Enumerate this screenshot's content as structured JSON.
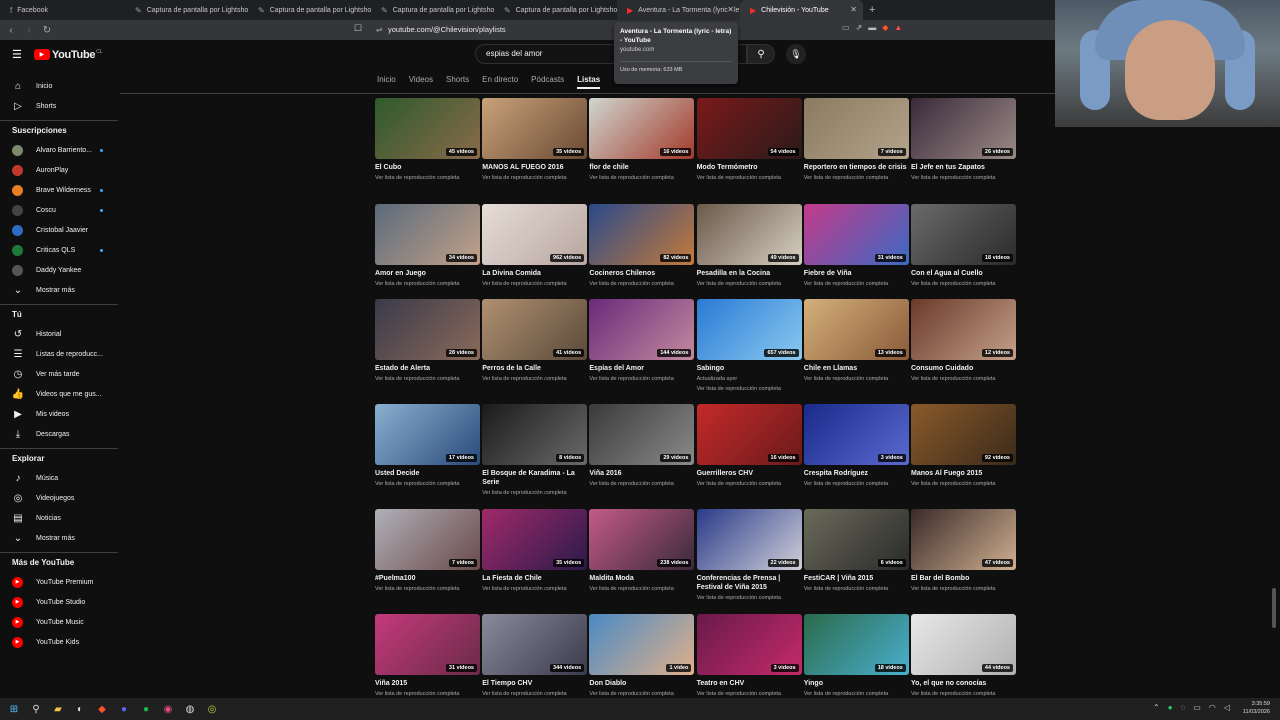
{
  "browser": {
    "tabs": [
      {
        "title": "Facebook",
        "icon": "facebook-icon"
      },
      {
        "title": "Captura de pantalla por Lightshot",
        "icon": "feather-icon"
      },
      {
        "title": "Captura de pantalla por Lightshot",
        "icon": "feather-icon"
      },
      {
        "title": "Captura de pantalla por Lightshot",
        "icon": "feather-icon"
      },
      {
        "title": "Captura de pantalla por Lightshot",
        "icon": "feather-icon"
      },
      {
        "title": "Aventura - La Tormenta (lyric - le",
        "icon": "youtube-icon"
      },
      {
        "title": "Chilevisión - YouTube",
        "icon": "youtube-icon"
      }
    ],
    "new_tab": "+",
    "url": "youtube.com/@Chilevision/playlists",
    "tooltip": {
      "title": "Aventura - La Tormenta (lyric - letra) - YouTube",
      "domain": "youtube.com",
      "memory": "Uso de memoria: 633 MB"
    }
  },
  "youtube": {
    "logo": "YouTube",
    "logo_country": "CL",
    "search_value": "espias del amor",
    "channel_tabs": [
      "Inicio",
      "Videos",
      "Shorts",
      "En directo",
      "Pódcasts",
      "Listas"
    ],
    "active_tab": "Listas"
  },
  "sidebar": {
    "main": [
      {
        "label": "Inicio",
        "icon": "home-icon"
      },
      {
        "label": "Shorts",
        "icon": "shorts-icon"
      }
    ],
    "subs_header": "Suscripciones",
    "subscriptions": [
      {
        "label": "Alvaro Barriento...",
        "color": "#7a8a6a"
      },
      {
        "label": "AuronPlay",
        "color": "#c0392b"
      },
      {
        "label": "Brave Wilderness",
        "color": "#e67e22"
      },
      {
        "label": "Coscu",
        "color": "#444444"
      },
      {
        "label": "Cristobal Jaavier",
        "color": "#2d6bc4"
      },
      {
        "label": "Criticas QLS",
        "color": "#1f7a3a"
      },
      {
        "label": "Daddy Yankee",
        "color": "#555555"
      }
    ],
    "show_more": "Mostrar más",
    "you_header": "Tú",
    "you": [
      {
        "label": "Historial",
        "icon": "history-icon"
      },
      {
        "label": "Listas de reproducc...",
        "icon": "playlist-icon"
      },
      {
        "label": "Ver más tarde",
        "icon": "clock-icon"
      },
      {
        "label": "Videos que me gus...",
        "icon": "thumbs-up-icon"
      },
      {
        "label": "Mis videos",
        "icon": "video-icon"
      },
      {
        "label": "Descargas",
        "icon": "download-icon"
      }
    ],
    "explore_header": "Explorar",
    "explore": [
      {
        "label": "Música",
        "icon": "music-icon"
      },
      {
        "label": "Videojuegos",
        "icon": "gamepad-icon"
      },
      {
        "label": "Noticias",
        "icon": "news-icon"
      },
      {
        "label": "Mostrar más",
        "icon": "chevron-down-icon"
      }
    ],
    "more_header": "Más de YouTube",
    "more": [
      {
        "label": "YouTube Premium"
      },
      {
        "label": "YouTube Studio"
      },
      {
        "label": "YouTube Music"
      },
      {
        "label": "YouTube Kids"
      }
    ]
  },
  "playlists": [
    {
      "title": "El Cubo",
      "count": "45 videos",
      "sub": "Ver lista de reproducción completa",
      "c1": "#2f5a2c",
      "c2": "#8a6a4a"
    },
    {
      "title": "MANOS AL FUEGO 2016",
      "count": "35 videos",
      "sub": "Ver lista de reproducción completa",
      "c1": "#c9a27a",
      "c2": "#6b4a34"
    },
    {
      "title": "flor de chile",
      "count": "16 videos",
      "sub": "Ver lista de reproducción completa",
      "c1": "#cfd6d0",
      "c2": "#a33a2a"
    },
    {
      "title": "Modo Termómetro",
      "count": "54 videos",
      "sub": "Ver lista de reproducción completa",
      "c1": "#7a1a1a",
      "c2": "#2a1a1a"
    },
    {
      "title": "Reportero en tiempos de crisis",
      "count": "7 videos",
      "sub": "Ver lista de reproducción completa",
      "c1": "#8a7a60",
      "c2": "#b2a38a"
    },
    {
      "title": "El Jefe en tus Zapatos",
      "count": "26 videos",
      "sub": "Ver lista de reproducción completa",
      "c1": "#3a2a3a",
      "c2": "#9a8a86"
    },
    {
      "title": "Amor en Juego",
      "count": "34 videos",
      "sub": "Ver lista de reproducción completa",
      "c1": "#5a6a7a",
      "c2": "#c2a28a"
    },
    {
      "title": "La Divina Comida",
      "count": "962 videos",
      "sub": "Ver lista de reproducción completa",
      "c1": "#e6dcd6",
      "c2": "#b8a6a0"
    },
    {
      "title": "Cocineros Chilenos",
      "count": "82 videos",
      "sub": "Ver lista de reproducción completa",
      "c1": "#2a4a8a",
      "c2": "#c47a3a"
    },
    {
      "title": "Pesadilla en la Cocina",
      "count": "49 videos",
      "sub": "Ver lista de reproducción completa",
      "c1": "#6a5a4a",
      "c2": "#d8cfc4"
    },
    {
      "title": "Fiebre de Viña",
      "count": "31 videos",
      "sub": "Ver lista de reproducción completa",
      "c1": "#c43a8a",
      "c2": "#3a6ac4"
    },
    {
      "title": "Con el Agua al Cuello",
      "count": "18 videos",
      "sub": "Ver lista de reproducción completa",
      "c1": "#6a6a6a",
      "c2": "#2a2a2a"
    },
    {
      "title": "Estado de Alerta",
      "count": "28 videos",
      "sub": "Ver lista de reproducción completa",
      "c1": "#3a3a4a",
      "c2": "#8a6a5a"
    },
    {
      "title": "Perros de la Calle",
      "count": "41 videos",
      "sub": "Ver lista de reproducción completa",
      "c1": "#b09070",
      "c2": "#5a4a3a"
    },
    {
      "title": "Espías del Amor",
      "count": "144 videos",
      "sub": "Ver lista de reproducción completa",
      "c1": "#6a2a7a",
      "c2": "#c48aa0"
    },
    {
      "title": "Sabingo",
      "count": "657 videos",
      "sub": "Actualizada ayer",
      "sub2": "Ver lista de reproducción completa",
      "c1": "#2a7ad4",
      "c2": "#8acaf0"
    },
    {
      "title": "Chile en Llamas",
      "count": "13 videos",
      "sub": "Ver lista de reproducción completa",
      "c1": "#d4b07a",
      "c2": "#8a5a3a"
    },
    {
      "title": "Consumo Cuidado",
      "count": "12 videos",
      "sub": "Ver lista de reproducción completa",
      "c1": "#6a3a2a",
      "c2": "#c4a08a"
    },
    {
      "title": "Usted Decide",
      "count": "17 videos",
      "sub": "Ver lista de reproducción completa",
      "c1": "#8ab0d0",
      "c2": "#2a4a7a"
    },
    {
      "title": "El Bosque de Karadima - La Serie",
      "count": "8 videos",
      "sub": "Ver lista de reproducción completa",
      "c1": "#1a1a1a",
      "c2": "#6a6a6a"
    },
    {
      "title": "Viña 2016",
      "count": "29 videos",
      "sub": "Ver lista de reproducción completa",
      "c1": "#3a3a3a",
      "c2": "#8a8a8a"
    },
    {
      "title": "Guerrilleros CHV",
      "count": "16 videos",
      "sub": "Ver lista de reproducción completa",
      "c1": "#c42a2a",
      "c2": "#6a1a1a"
    },
    {
      "title": "Crespita Rodríguez",
      "count": "3 videos",
      "sub": "Ver lista de reproducción completa",
      "c1": "#1a2a8a",
      "c2": "#5a6ad0"
    },
    {
      "title": "Manos Al Fuego 2015",
      "count": "92 videos",
      "sub": "Ver lista de reproducción completa",
      "c1": "#8a5a2a",
      "c2": "#3a2a1a"
    },
    {
      "title": "#Puelma100",
      "count": "7 videos",
      "sub": "Ver lista de reproducción completa",
      "c1": "#b0b0b8",
      "c2": "#6a4a4a"
    },
    {
      "title": "La Fiesta de Chile",
      "count": "35 videos",
      "sub": "Ver lista de reproducción completa",
      "c1": "#a02a6a",
      "c2": "#2a1a4a"
    },
    {
      "title": "Maldita Moda",
      "count": "238 videos",
      "sub": "Ver lista de reproducción completa",
      "c1": "#c45a8a",
      "c2": "#3a2a3a"
    },
    {
      "title": "Conferencias de Prensa | Festival de Viña 2015",
      "count": "22 videos",
      "sub": "Ver lista de reproducción completa",
      "c1": "#2a3a8a",
      "c2": "#d0d0d8"
    },
    {
      "title": "FestiCAR | Viña 2015",
      "count": "6 videos",
      "sub": "Ver lista de reproducción completa",
      "c1": "#6a6a5a",
      "c2": "#2a2a2a"
    },
    {
      "title": "El Bar del Bombo",
      "count": "47 videos",
      "sub": "Ver lista de reproducción completa",
      "c1": "#3a2a2a",
      "c2": "#d0b090"
    },
    {
      "title": "Viña 2015",
      "count": "31 videos",
      "sub": "Ver lista de reproducción completa",
      "c1": "#c43a7a",
      "c2": "#6a2a4a"
    },
    {
      "title": "El Tiempo CHV",
      "count": "344 videos",
      "sub": "Ver lista de reproducción completa",
      "c1": "#8a8a9a",
      "c2": "#3a3a4a"
    },
    {
      "title": "Don Diablo",
      "count": "1 video",
      "sub": "Ver lista de reproducción completa",
      "c1": "#4a8ac4",
      "c2": "#e0b08a"
    },
    {
      "title": "Teatro en CHV",
      "count": "3 videos",
      "sub": "Ver lista de reproducción completa",
      "c1": "#6a1a4a",
      "c2": "#c42a6a"
    },
    {
      "title": "Yingo",
      "count": "18 videos",
      "sub": "Ver lista de reproducción completa",
      "c1": "#2a6a4a",
      "c2": "#4ab0d0"
    },
    {
      "title": "Yo, el que no conocías",
      "count": "44 videos",
      "sub": "Ver lista de reproducción completa",
      "c1": "#e8e8e8",
      "c2": "#b0b0b0"
    }
  ],
  "taskbar": {
    "time": "3:35:59",
    "date": "11/03/2026"
  }
}
